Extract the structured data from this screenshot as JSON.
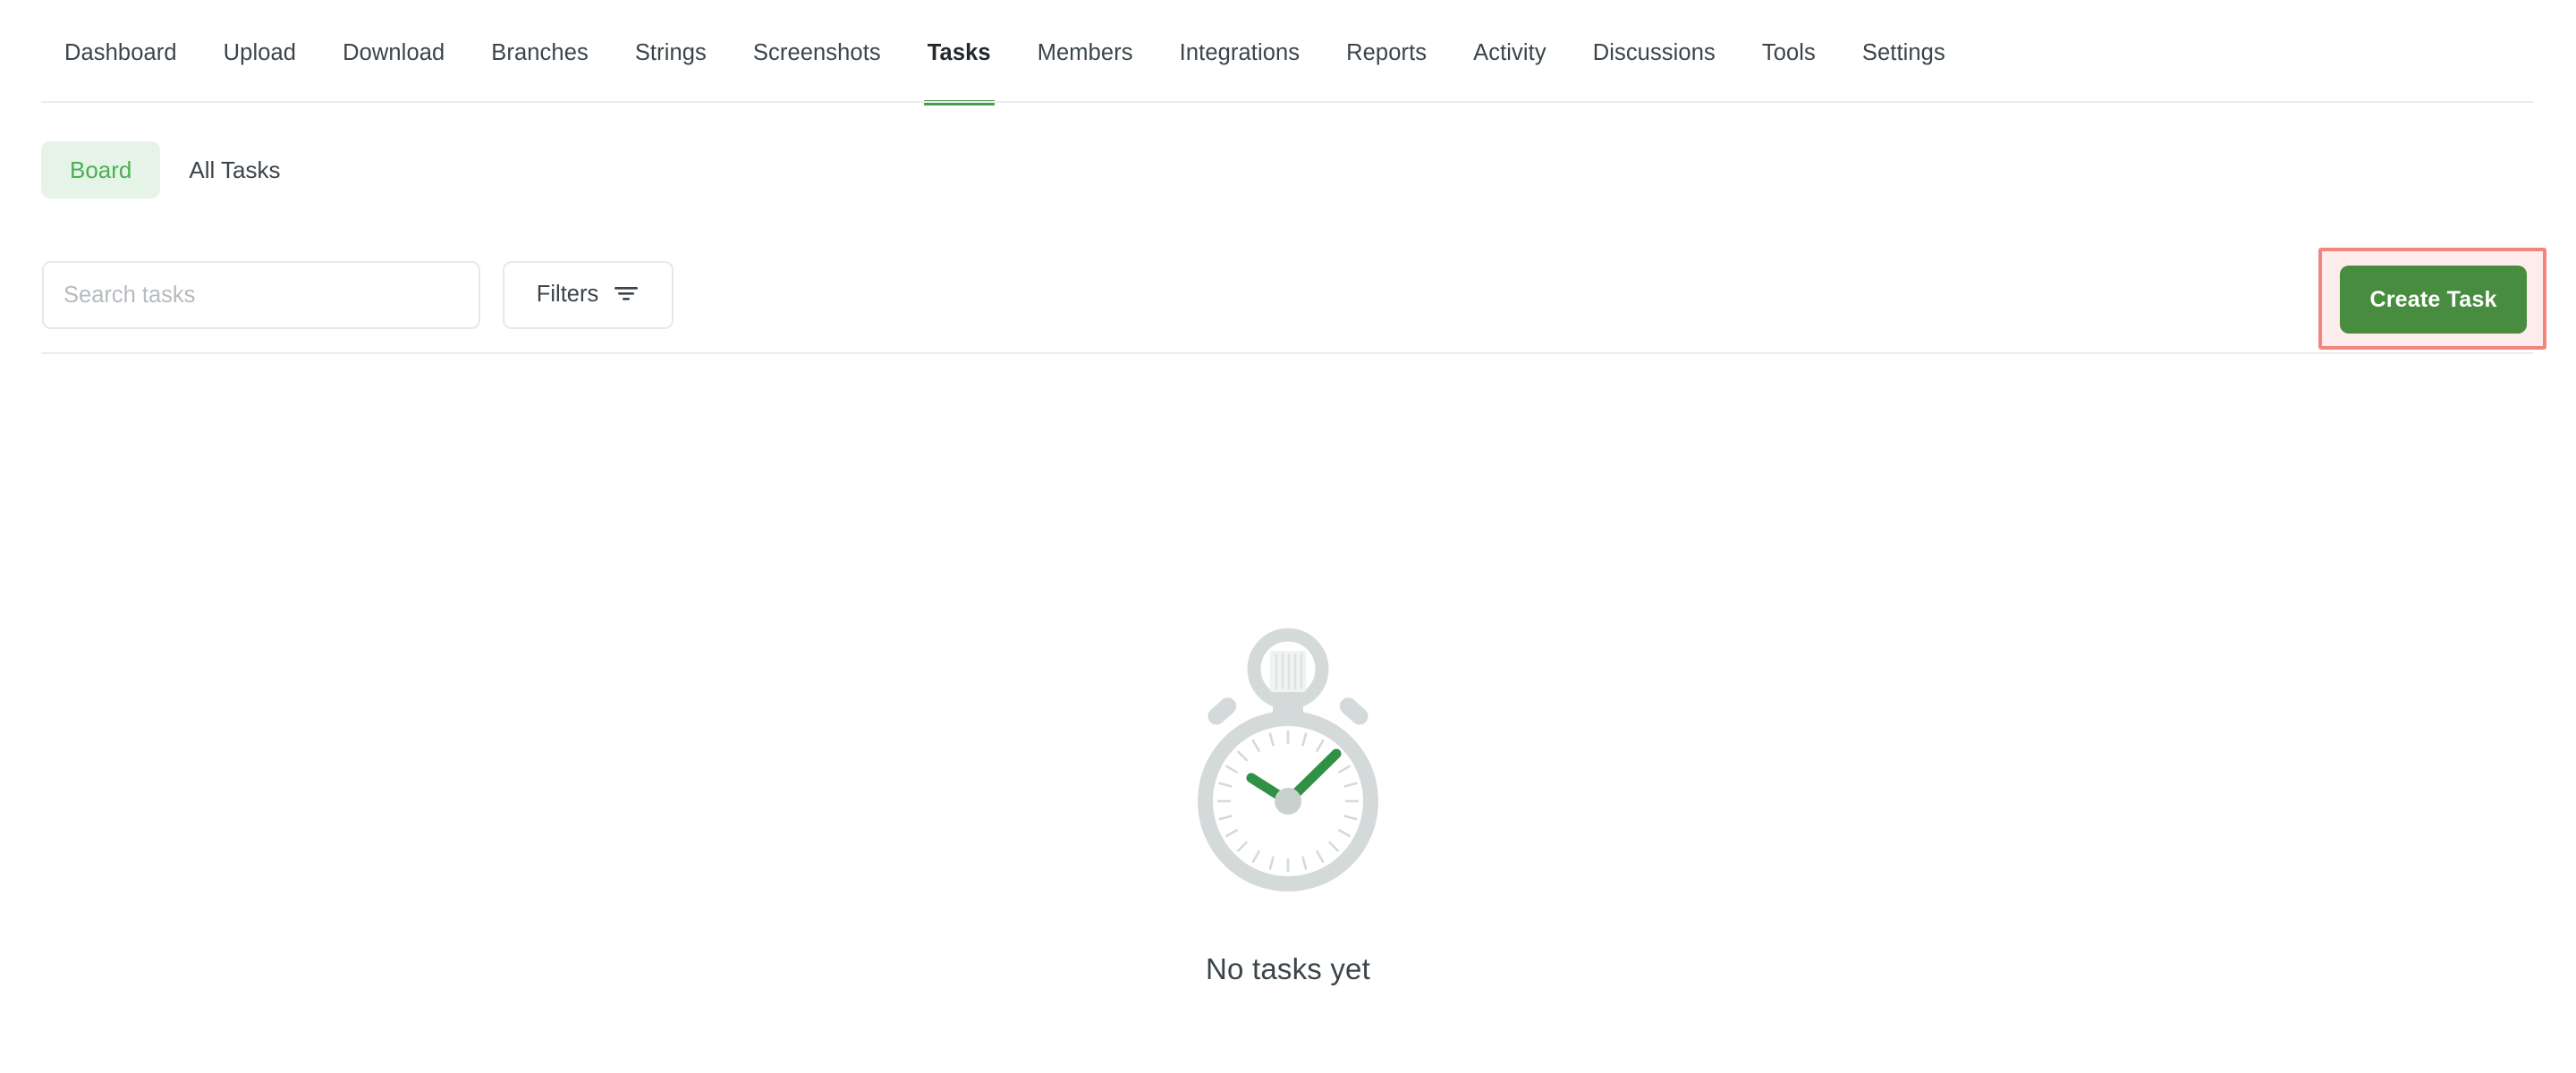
{
  "nav": {
    "items": [
      {
        "label": "Dashboard",
        "active": false
      },
      {
        "label": "Upload",
        "active": false
      },
      {
        "label": "Download",
        "active": false
      },
      {
        "label": "Branches",
        "active": false
      },
      {
        "label": "Strings",
        "active": false
      },
      {
        "label": "Screenshots",
        "active": false
      },
      {
        "label": "Tasks",
        "active": true
      },
      {
        "label": "Members",
        "active": false
      },
      {
        "label": "Integrations",
        "active": false
      },
      {
        "label": "Reports",
        "active": false
      },
      {
        "label": "Activity",
        "active": false
      },
      {
        "label": "Discussions",
        "active": false
      },
      {
        "label": "Tools",
        "active": false
      },
      {
        "label": "Settings",
        "active": false
      }
    ]
  },
  "view_tabs": [
    {
      "label": "Board",
      "active": true
    },
    {
      "label": "All Tasks",
      "active": false
    }
  ],
  "toolbar": {
    "create_task_label": "Create Task",
    "create_task_color": "#478c3f",
    "highlight_border_color": "#f2867f",
    "highlight_fill_color": "#fdeceb"
  },
  "search": {
    "value": "",
    "placeholder": "Search tasks"
  },
  "filters": {
    "label": "Filters",
    "icon": "filter-icon"
  },
  "empty_state": {
    "illustration": "stopwatch-icon",
    "title": "No tasks yet",
    "accent_color": "#2e9144",
    "body_color": "#d4dad9"
  }
}
